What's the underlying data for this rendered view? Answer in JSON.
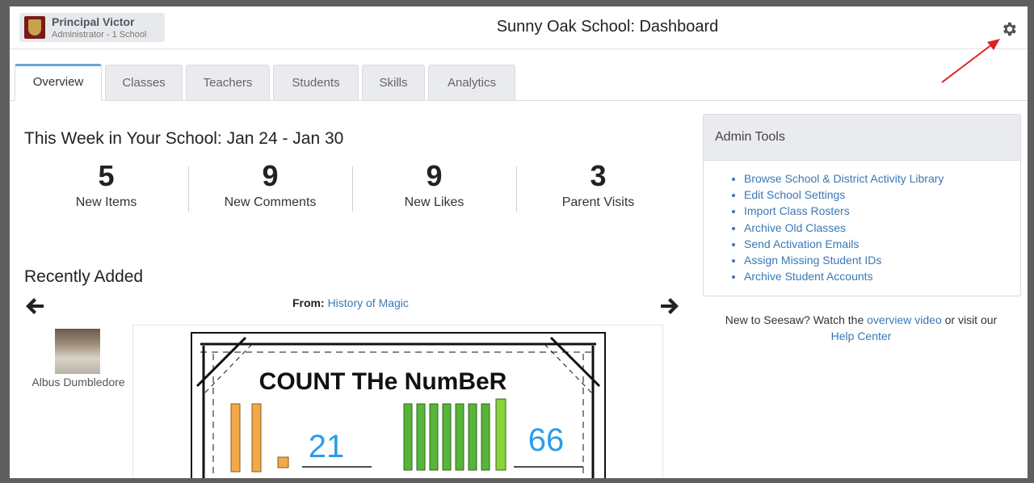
{
  "header": {
    "user_name": "Principal Victor",
    "user_role": "Administrator - 1 School",
    "title": "Sunny Oak School: Dashboard",
    "settings_icon": "gear-icon"
  },
  "tabs": [
    {
      "label": "Overview",
      "active": true
    },
    {
      "label": "Classes",
      "active": false
    },
    {
      "label": "Teachers",
      "active": false
    },
    {
      "label": "Students",
      "active": false
    },
    {
      "label": "Skills",
      "active": false
    },
    {
      "label": "Analytics",
      "active": false
    }
  ],
  "week": {
    "title": "This Week in Your School: Jan 24 - Jan 30",
    "stats": [
      {
        "value": "5",
        "label": "New Items"
      },
      {
        "value": "9",
        "label": "New Comments"
      },
      {
        "value": "9",
        "label": "New Likes"
      },
      {
        "value": "3",
        "label": "Parent Visits"
      }
    ]
  },
  "recent": {
    "title": "Recently Added",
    "from_label": "From:",
    "from_class": "History of Magic",
    "author": "Albus Dumbledore",
    "worksheet": {
      "title": "COUNT THe NumBeR",
      "answers": [
        "21",
        "66"
      ]
    }
  },
  "admin_tools": {
    "title": "Admin Tools",
    "links": [
      "Browse School & District Activity Library",
      "Edit School Settings",
      "Import Class Rosters",
      "Archive Old Classes",
      "Send Activation Emails",
      "Assign Missing Student IDs",
      "Archive Student Accounts"
    ]
  },
  "help": {
    "text1": "New to Seesaw? Watch the",
    "link1": "overview video",
    "text2": "or visit our",
    "link2": "Help Center"
  },
  "colors": {
    "link": "#3a78b5",
    "active_tab_accent": "#6aa6d8",
    "annotation_arrow": "#e02020"
  }
}
